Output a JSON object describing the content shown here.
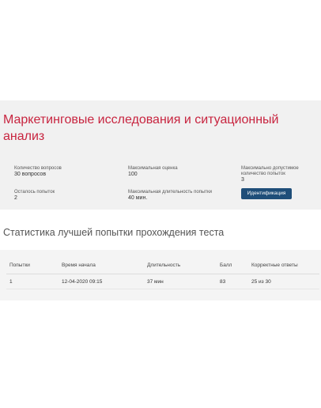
{
  "test": {
    "title": "Маркетинговые исследования и ситуационный анализ"
  },
  "info": {
    "questions_count_label": "Количество вопросов",
    "questions_count_value": "30 вопросов",
    "max_score_label": "Максимальная оценка",
    "max_score_value": "100",
    "max_attempts_label": "Максимально допустимое количество попыток",
    "max_attempts_value": "3",
    "attempts_left_label": "Осталось попыток",
    "attempts_left_value": "2",
    "max_duration_label": "Максимальная длительность попытки",
    "max_duration_value": "40 мин.",
    "identify_button": "Идентификация"
  },
  "accent_color": "#c8243f",
  "button_color": "#1f4e79",
  "stats": {
    "title": "Статистика лучшей попытки прохождения теста",
    "columns": [
      "Попытки",
      "Время начала",
      "Длительность",
      "Балл",
      "Корректные ответы"
    ],
    "rows": [
      [
        "1",
        "12-04-2020 09:15",
        "37 мин",
        "83",
        "25 из 30"
      ]
    ]
  }
}
